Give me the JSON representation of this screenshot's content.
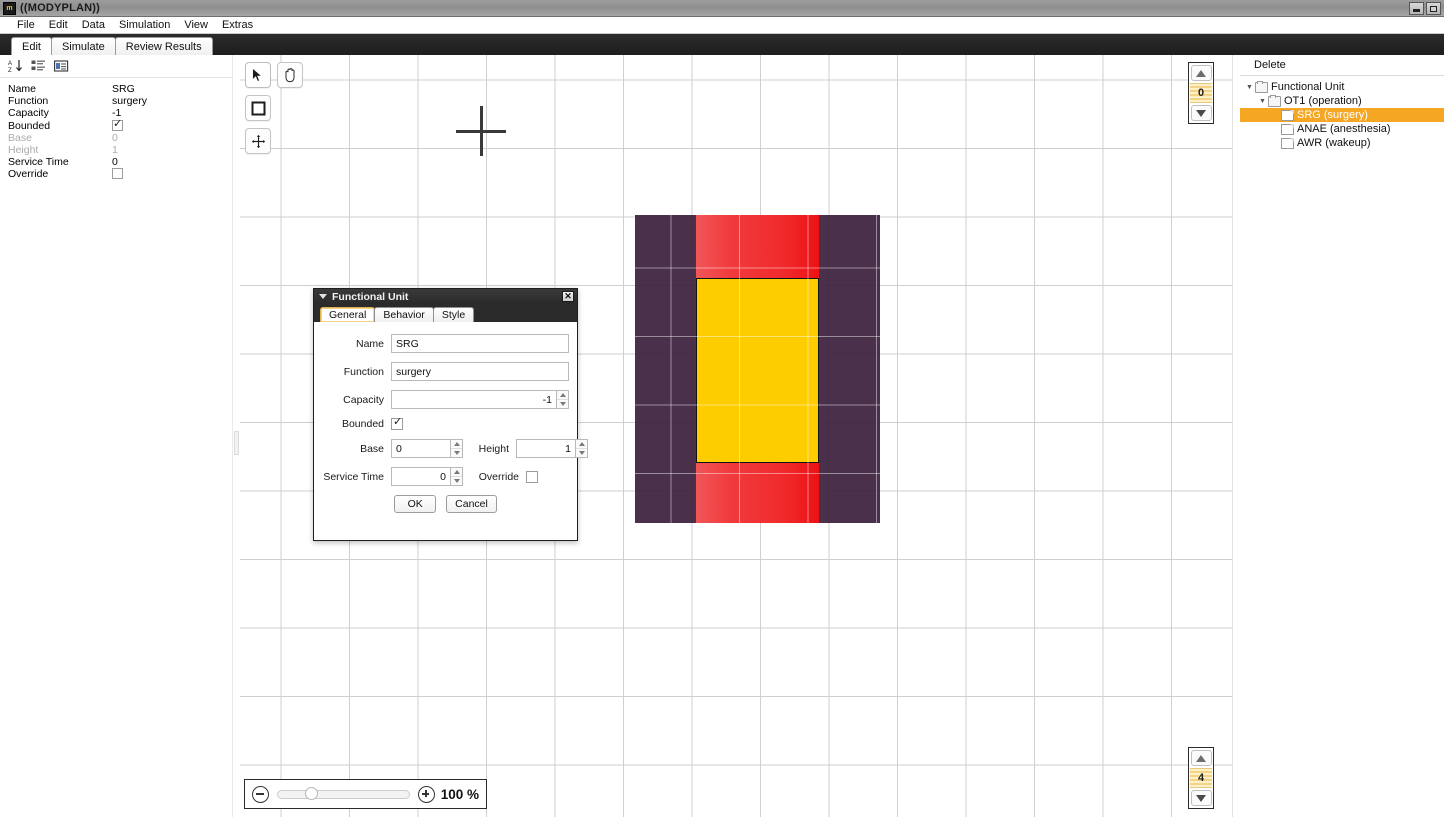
{
  "window": {
    "title": "((MODYPLAN))",
    "app_icon": "m",
    "buttons": {
      "minimize": "minimize-icon",
      "maximize": "maximize-icon"
    }
  },
  "menubar": {
    "items": [
      "File",
      "Edit",
      "Data",
      "Simulation",
      "View",
      "Extras"
    ]
  },
  "tabstrip": {
    "tabs": [
      {
        "label": "Edit",
        "active": true
      },
      {
        "label": "Simulate",
        "active": false
      },
      {
        "label": "Review Results",
        "active": false
      }
    ]
  },
  "property_panel": {
    "toolbar_icons": [
      "sort-alphabetic-icon",
      "categorized-icon",
      "property-pages-icon"
    ],
    "rows": [
      {
        "name": "Name",
        "value": "SRG",
        "type": "text",
        "disabled": false
      },
      {
        "name": "Function",
        "value": "surgery",
        "type": "text",
        "disabled": false
      },
      {
        "name": "Capacity",
        "value": "-1",
        "type": "text",
        "disabled": false
      },
      {
        "name": "Bounded",
        "value": "",
        "type": "checkbox",
        "checked": true,
        "disabled": false
      },
      {
        "name": "Base",
        "value": "0",
        "type": "text",
        "disabled": true
      },
      {
        "name": "Height",
        "value": "1",
        "type": "text",
        "disabled": true
      },
      {
        "name": "Service Time",
        "value": "0",
        "type": "text",
        "disabled": false
      },
      {
        "name": "Override",
        "value": "",
        "type": "checkbox",
        "checked": false,
        "disabled": false
      }
    ]
  },
  "canvas": {
    "tools": [
      {
        "icon": "pointer-icon",
        "selected": true
      },
      {
        "icon": "hand-icon",
        "selected": false
      },
      {
        "icon": "rectangle-icon",
        "selected": false
      },
      {
        "icon": "move-icon",
        "selected": false
      }
    ],
    "shape": {
      "outer_color": "#3c1e3c",
      "band_color": "#ff3b3b",
      "core_color": "#fdcd00"
    },
    "floor_spinner_top": {
      "value": "0"
    },
    "floor_spinner_bottom": {
      "value": "4"
    },
    "zoom": {
      "minus_icon": "zoom-out-icon",
      "plus_icon": "zoom-in-icon",
      "level": "100 %",
      "slider_position_percent": 25
    }
  },
  "right_panel": {
    "header": "Delete",
    "tree": [
      {
        "label": "Functional Unit",
        "depth": 0,
        "icon": "folder",
        "expanded": true,
        "selected": false
      },
      {
        "label": "OT1 (operation)",
        "depth": 1,
        "icon": "folder",
        "expanded": true,
        "selected": false
      },
      {
        "label": "SRG (surgery)",
        "depth": 2,
        "icon": "file",
        "expanded": null,
        "selected": true
      },
      {
        "label": "ANAE (anesthesia)",
        "depth": 2,
        "icon": "file",
        "expanded": null,
        "selected": false
      },
      {
        "label": "AWR (wakeup)",
        "depth": 2,
        "icon": "file",
        "expanded": null,
        "selected": false
      }
    ],
    "selection_color": "#f5a623"
  },
  "dialog": {
    "title": "Functional Unit",
    "close_label": "✕",
    "tabs": [
      {
        "label": "General",
        "active": true
      },
      {
        "label": "Behavior",
        "active": false
      },
      {
        "label": "Style",
        "active": false
      }
    ],
    "fields": {
      "name_label": "Name",
      "name_value": "SRG",
      "function_label": "Function",
      "function_value": "surgery",
      "capacity_label": "Capacity",
      "capacity_value": "-1",
      "bounded_label": "Bounded",
      "bounded_checked": true,
      "base_label": "Base",
      "base_value": "0",
      "height_label": "Height",
      "height_value": "1",
      "service_time_label": "Service Time",
      "service_time_value": "0",
      "override_label": "Override",
      "override_checked": false
    },
    "ok_label": "OK",
    "cancel_label": "Cancel"
  }
}
